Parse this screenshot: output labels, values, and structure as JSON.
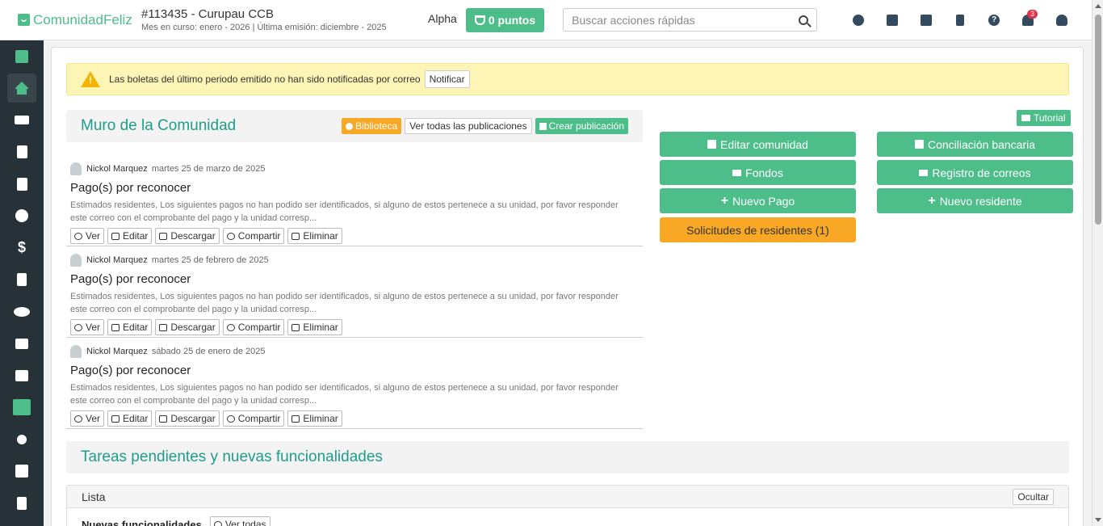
{
  "header": {
    "brand": "ComunidadFeliz",
    "community_name": "#113435 - Curupau CCB",
    "community_sub": "Mes en curso: enero - 2026 | Última emisión: diciembre - 2025",
    "alpha_label": "Alpha",
    "points_label": "0 puntos",
    "search_placeholder": "Buscar acciones rápidas",
    "notification_count": "3"
  },
  "alert": {
    "text": "Las boletas del último periodo emitido no han sido notificadas por correo",
    "button": "Notificar"
  },
  "wall": {
    "title": "Muro de la Comunidad",
    "library_label": "Biblioteca",
    "all_posts_label": "Ver todas las publicaciones",
    "create_label": "Crear publicación",
    "posts": [
      {
        "author": "Nickol Marquez",
        "date": "martes 25 de marzo de 2025",
        "title": "Pago(s) por reconocer",
        "body": "Estimados residentes, Los siguientes pagos no han podido ser identificados, si alguno de estos pertenece a su unidad, por favor responder este correo con el comprobante del pago y la unidad corresp..."
      },
      {
        "author": "Nickol Marquez",
        "date": "martes 25 de febrero de 2025",
        "title": "Pago(s) por reconocer",
        "body": "Estimados residentes, Los siguientes pagos no han podido ser identificados, si alguno de estos pertenece a su unidad, por favor responder este correo con el comprobante del pago y la unidad corresp..."
      },
      {
        "author": "Nickol Marquez",
        "date": "sábado 25 de enero de 2025",
        "title": "Pago(s) por reconocer",
        "body": "Estimados residentes, Los siguientes pagos no han podido ser identificados, si alguno de estos pertenece a su unidad, por favor responder este correo con el comprobante del pago y la unidad corresp..."
      }
    ],
    "actions": {
      "view": "Ver",
      "edit": "Editar",
      "download": "Descargar",
      "share": "Compartir",
      "delete": "Eliminar"
    }
  },
  "quick_actions": {
    "tutorial": "Tutorial",
    "edit_community": "Editar comunidad",
    "bank_reconciliation": "Conciliación bancaria",
    "funds": "Fondos",
    "email_log": "Registro de correos",
    "new_payment": "Nuevo Pago",
    "new_resident": "Nuevo residente",
    "resident_requests": "Solicitudes de residentes (1)"
  },
  "tasks": {
    "title": "Tareas pendientes y nuevas funcionalidades",
    "list_title": "Lista",
    "hide_label": "Ocultar",
    "new_features_label": "Nuevas funcionalidades",
    "view_all_label": "Ver todas"
  },
  "colors": {
    "brand_green": "#4dbd8a",
    "title_teal": "#1e9d8b",
    "sidebar_bg": "#263238",
    "amber": "#f9a825",
    "alert_bg": "#fcf5b6"
  }
}
